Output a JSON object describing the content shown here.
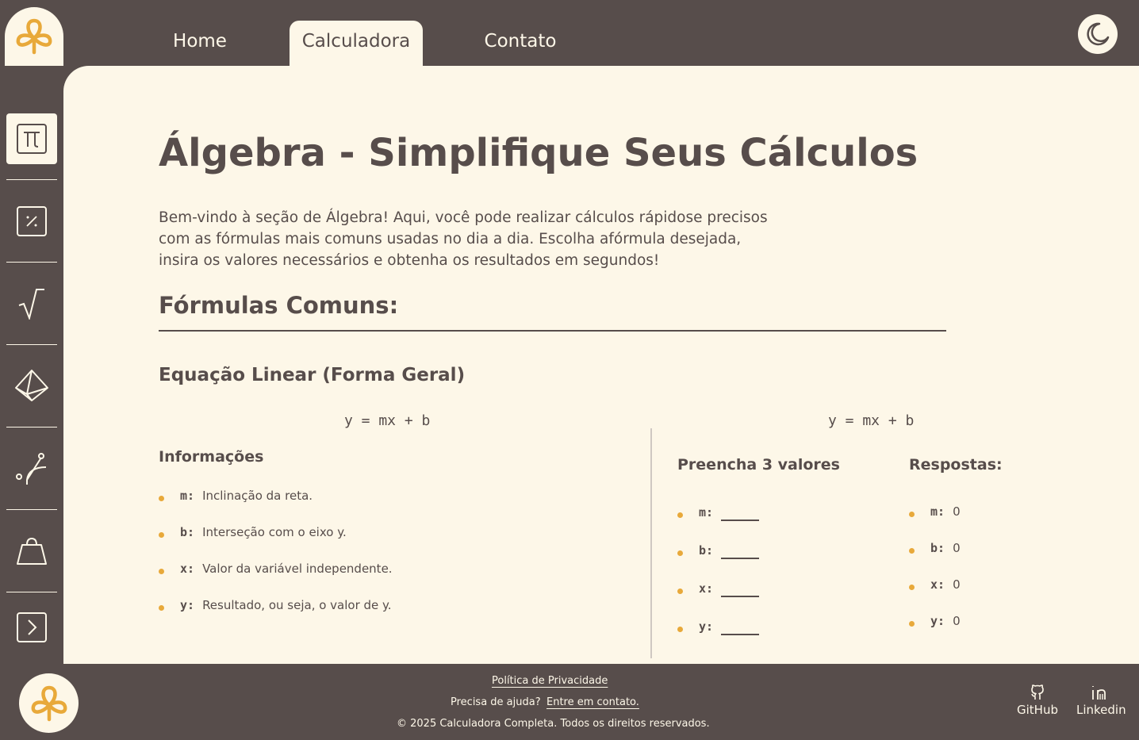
{
  "nav": {
    "tabs": [
      {
        "label": "Home"
      },
      {
        "label": "Calculadora"
      },
      {
        "label": "Contato"
      }
    ]
  },
  "page": {
    "title": "Álgebra - Simplifique Seus Cálculos",
    "intro": "Bem-vindo à seção de Álgebra! Aqui, você pode realizar cálculos rápidose precisos com as fórmulas mais comuns usadas no dia a dia. Escolha afórmula desejada, insira os valores necessários e obtenha os resultados em segundos!",
    "section_title": "Fórmulas Comuns:"
  },
  "formula": {
    "title": "Equação Linear (Forma Geral)",
    "equation_left": "y = mx + b",
    "equation_right": "y = mx + b",
    "info_heading": "Informações",
    "info": [
      {
        "var": "m:",
        "desc": "Inclinação da reta."
      },
      {
        "var": "b:",
        "desc": "Interseção com o eixo y."
      },
      {
        "var": "x:",
        "desc": "Valor da variável independente."
      },
      {
        "var": "y:",
        "desc": "Resultado, ou seja, o valor de y."
      }
    ],
    "fill_heading": "Preencha 3 valores",
    "inputs": [
      {
        "var": "m:",
        "value": ""
      },
      {
        "var": "b:",
        "value": ""
      },
      {
        "var": "x:",
        "value": ""
      },
      {
        "var": "y:",
        "value": ""
      }
    ],
    "answers_heading": "Respostas:",
    "answers": [
      {
        "var": "m:",
        "value": "0"
      },
      {
        "var": "b:",
        "value": "0"
      },
      {
        "var": "x:",
        "value": "0"
      },
      {
        "var": "y:",
        "value": "0"
      }
    ]
  },
  "footer": {
    "privacy": "Política de Privacidade",
    "help_text": "Precisa de ajuda?",
    "contact_link": "Entre em contato.",
    "copyright": "© 2025 Calculadora Completa. Todos os direitos reservados.",
    "github": "GitHub",
    "linkedin": "Linkedin"
  },
  "colors": {
    "dark": "#574d4b",
    "cream": "#fdf7e8",
    "accent": "#e8a93a"
  },
  "icons": {
    "logo": "trefoil-logo-icon",
    "theme": "moon-icon",
    "sidebar": [
      "pi-icon",
      "percent-icon",
      "square-root-icon",
      "pyramid-icon",
      "trajectory-icon",
      "weight-icon",
      "chevron-right-icon"
    ]
  }
}
